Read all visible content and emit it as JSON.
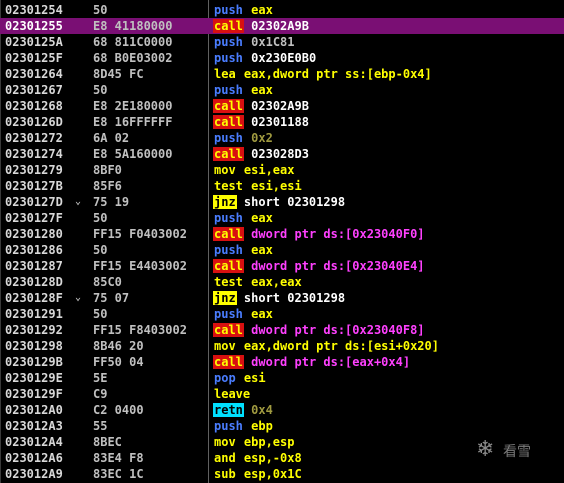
{
  "rows": [
    {
      "addr": "02301254",
      "bytes": "50",
      "arrow": "",
      "ops": [
        {
          "t": "push",
          "c": "mn-push"
        },
        {
          "t": " "
        },
        {
          "t": "eax",
          "c": "t-reg"
        }
      ]
    },
    {
      "addr": "02301255",
      "bytes": "E8 41180000",
      "arrow": "",
      "selected": true,
      "ops": [
        {
          "t": "call",
          "c": "mn-call"
        },
        {
          "t": " "
        },
        {
          "t": "02302A9B",
          "c": "t-target"
        }
      ]
    },
    {
      "addr": "0230125A",
      "bytes": "68 811C0000",
      "arrow": "",
      "ops": [
        {
          "t": "push",
          "c": "mn-push"
        },
        {
          "t": " "
        },
        {
          "t": "0x1C81",
          "c": "t-imm"
        }
      ]
    },
    {
      "addr": "0230125F",
      "bytes": "68 B0E03002",
      "arrow": "",
      "ops": [
        {
          "t": "push",
          "c": "mn-push"
        },
        {
          "t": " "
        },
        {
          "t": "0x230E0B0",
          "c": "t-target"
        }
      ]
    },
    {
      "addr": "02301264",
      "bytes": "8D45 FC",
      "arrow": "",
      "ops": [
        {
          "t": "lea",
          "c": "mn-lea"
        },
        {
          "t": " eax,dword ptr ss:[ebp-0x4]",
          "c": "t-plain"
        }
      ]
    },
    {
      "addr": "02301267",
      "bostes": "",
      "bytes": "50",
      "arrow": "",
      "ops": [
        {
          "t": "push",
          "c": "mn-push"
        },
        {
          "t": " "
        },
        {
          "t": "eax",
          "c": "t-reg"
        }
      ]
    },
    {
      "addr": "02301268",
      "bytes": "E8 2E180000",
      "arrow": "",
      "ops": [
        {
          "t": "call",
          "c": "mn-call"
        },
        {
          "t": " "
        },
        {
          "t": "02302A9B",
          "c": "t-target"
        }
      ]
    },
    {
      "addr": "0230126D",
      "bytes": "E8 16FFFFFF",
      "arrow": "",
      "ops": [
        {
          "t": "call",
          "c": "mn-call"
        },
        {
          "t": " "
        },
        {
          "t": "02301188",
          "c": "t-target"
        }
      ]
    },
    {
      "addr": "02301272",
      "bytes": "6A 02",
      "arrow": "",
      "ops": [
        {
          "t": "push",
          "c": "mn-push"
        },
        {
          "t": " "
        },
        {
          "t": "0x2",
          "c": "t-immsmall"
        }
      ]
    },
    {
      "addr": "02301274",
      "bytes": "E8 5A160000",
      "arrow": "",
      "ops": [
        {
          "t": "call",
          "c": "mn-call"
        },
        {
          "t": " "
        },
        {
          "t": "023028D3",
          "c": "t-target"
        }
      ]
    },
    {
      "addr": "02301279",
      "bytes": "8BF0",
      "arrow": "",
      "ops": [
        {
          "t": "mov",
          "c": "mn-mov"
        },
        {
          "t": " esi,eax",
          "c": "t-plain"
        }
      ]
    },
    {
      "addr": "0230127B",
      "bytes": "85F6",
      "arrow": "",
      "ops": [
        {
          "t": "test",
          "c": "mn-test"
        },
        {
          "t": " esi,esi",
          "c": "t-plain"
        }
      ]
    },
    {
      "addr": "0230127D",
      "bytes": "75 19",
      "arrow": "⌄",
      "ops": [
        {
          "t": "jnz",
          "c": "mn-jnz"
        },
        {
          "t": " short 02301298",
          "c": "t-short"
        }
      ]
    },
    {
      "addr": "0230127F",
      "bytes": "50",
      "arrow": "",
      "ops": [
        {
          "t": "push",
          "c": "mn-push"
        },
        {
          "t": " "
        },
        {
          "t": "eax",
          "c": "t-reg"
        }
      ]
    },
    {
      "addr": "02301280",
      "bytes": "FF15 F0403002",
      "arrow": "",
      "ops": [
        {
          "t": "call",
          "c": "mn-call"
        },
        {
          "t": " "
        },
        {
          "t": "dword ptr ds:[0x23040F0]",
          "c": "t-mem"
        }
      ]
    },
    {
      "addr": "02301286",
      "bytes": "50",
      "arrow": "",
      "ops": [
        {
          "t": "push",
          "c": "mn-push"
        },
        {
          "t": " "
        },
        {
          "t": "eax",
          "c": "t-reg"
        }
      ]
    },
    {
      "addr": "02301287",
      "bytes": "FF15 E4403002",
      "arrow": "",
      "ops": [
        {
          "t": "call",
          "c": "mn-call"
        },
        {
          "t": " "
        },
        {
          "t": "dword ptr ds:[0x23040E4]",
          "c": "t-mem"
        }
      ]
    },
    {
      "addr": "0230128D",
      "bytes": "85C0",
      "arrow": "",
      "ops": [
        {
          "t": "test",
          "c": "mn-test"
        },
        {
          "t": " eax,eax",
          "c": "t-plain"
        }
      ]
    },
    {
      "addr": "0230128F",
      "bytes": "75 07",
      "arrow": "⌄",
      "ops": [
        {
          "t": "jnz",
          "c": "mn-jnz"
        },
        {
          "t": " short 02301298",
          "c": "t-short"
        }
      ]
    },
    {
      "addr": "02301291",
      "bytes": "50",
      "arrow": "",
      "ops": [
        {
          "t": "push",
          "c": "mn-push"
        },
        {
          "t": " "
        },
        {
          "t": "eax",
          "c": "t-reg"
        }
      ]
    },
    {
      "addr": "02301292",
      "bytes": "FF15 F8403002",
      "arrow": "",
      "ops": [
        {
          "t": "call",
          "c": "mn-call"
        },
        {
          "t": " "
        },
        {
          "t": "dword ptr ds:[0x23040F8]",
          "c": "t-mem"
        }
      ]
    },
    {
      "addr": "02301298",
      "bytes": "8B46 20",
      "arrow": "",
      "ops": [
        {
          "t": "mov",
          "c": "mn-mov"
        },
        {
          "t": " eax,dword ptr ds:[esi+0x20]",
          "c": "t-plain"
        }
      ]
    },
    {
      "addr": "0230129B",
      "bytes": "FF50 04",
      "arrow": "",
      "ops": [
        {
          "t": "call",
          "c": "mn-call"
        },
        {
          "t": " "
        },
        {
          "t": "dword ptr ds:[eax+0x4]",
          "c": "t-mem"
        }
      ]
    },
    {
      "addr": "0230129E",
      "bytes": "5E",
      "arrow": "",
      "ops": [
        {
          "t": "pop",
          "c": "mn-pop"
        },
        {
          "t": " "
        },
        {
          "t": "esi",
          "c": "t-reg"
        }
      ]
    },
    {
      "addr": "0230129F",
      "bytes": "C9",
      "arrow": "",
      "ops": [
        {
          "t": "leave",
          "c": "mn-leave"
        }
      ]
    },
    {
      "addr": "023012A0",
      "bytes": "C2 0400",
      "arrow": "",
      "ops": [
        {
          "t": "retn",
          "c": "mn-retn"
        },
        {
          "t": " "
        },
        {
          "t": "0x4",
          "c": "t-immsmall"
        }
      ]
    },
    {
      "addr": "023012A3",
      "bytes": "55",
      "arrow": "",
      "ops": [
        {
          "t": "push",
          "c": "mn-push"
        },
        {
          "t": " "
        },
        {
          "t": "ebp",
          "c": "t-reg"
        }
      ]
    },
    {
      "addr": "023012A4",
      "bytes": "8BEC",
      "arrow": "",
      "ops": [
        {
          "t": "mov",
          "c": "mn-mov"
        },
        {
          "t": " ebp,esp",
          "c": "t-plain"
        }
      ]
    },
    {
      "addr": "023012A6",
      "bytes": "83E4 F8",
      "arrow": "",
      "ops": [
        {
          "t": "and",
          "c": "mn-and"
        },
        {
          "t": " esp,-0x8",
          "c": "t-plain"
        }
      ]
    },
    {
      "addr": "023012A9",
      "bytes": "83EC 1C",
      "arrow": "",
      "ops": [
        {
          "t": "sub",
          "c": "mn-sub"
        },
        {
          "t": " esp,0x1C",
          "c": "t-plain"
        }
      ]
    }
  ],
  "watermark": {
    "text": "看雪",
    "icon": "snowflake-icon"
  },
  "colors": {
    "selected_row": "#7a0f74",
    "call_bg": "#d81010",
    "jnz_bg": "#ffff00",
    "retn_bg": "#00e0ff",
    "push": "#4a7dff",
    "memory": "#ff40ff"
  }
}
